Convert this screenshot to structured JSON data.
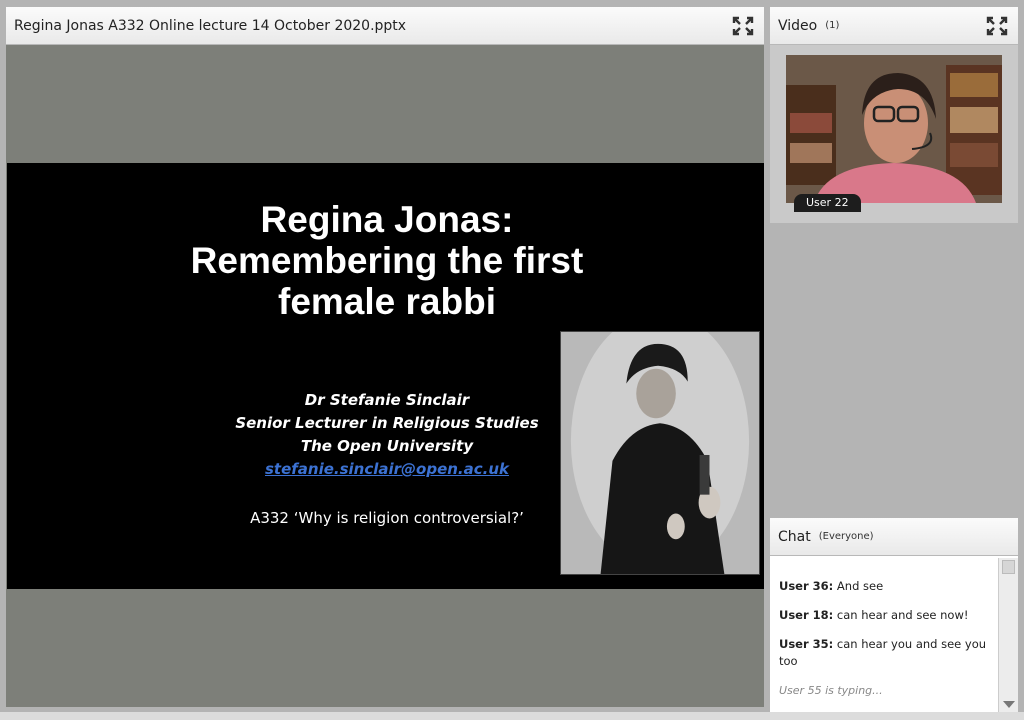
{
  "share_pod": {
    "title": "Regina Jonas A332 Online lecture 14 October 2020.pptx"
  },
  "slide": {
    "title_lines": [
      "Regina Jonas:",
      "Remembering the first",
      "female rabbi"
    ],
    "author_lines": [
      "Dr Stefanie Sinclair",
      "Senior Lecturer in Religious Studies",
      "The Open University"
    ],
    "email": "stefanie.sinclair@open.ac.uk",
    "course": "A332 ‘Why is religion controversial?’"
  },
  "video_pod": {
    "title": "Video",
    "count": "(1)",
    "user_label": "User 22"
  },
  "chat_pod": {
    "title": "Chat",
    "scope": "(Everyone)",
    "messages": [
      {
        "user": "User 36:",
        "text": "And see"
      },
      {
        "user": "User 18:",
        "text": "can hear and see now!"
      },
      {
        "user": "User 35:",
        "text": "can hear you and see you too"
      }
    ],
    "typing": "User 55 is typing..."
  },
  "colors": {
    "email_link": "#3c72d3",
    "slide_bg": "#000000",
    "stage_bg": "#7d7f79"
  }
}
